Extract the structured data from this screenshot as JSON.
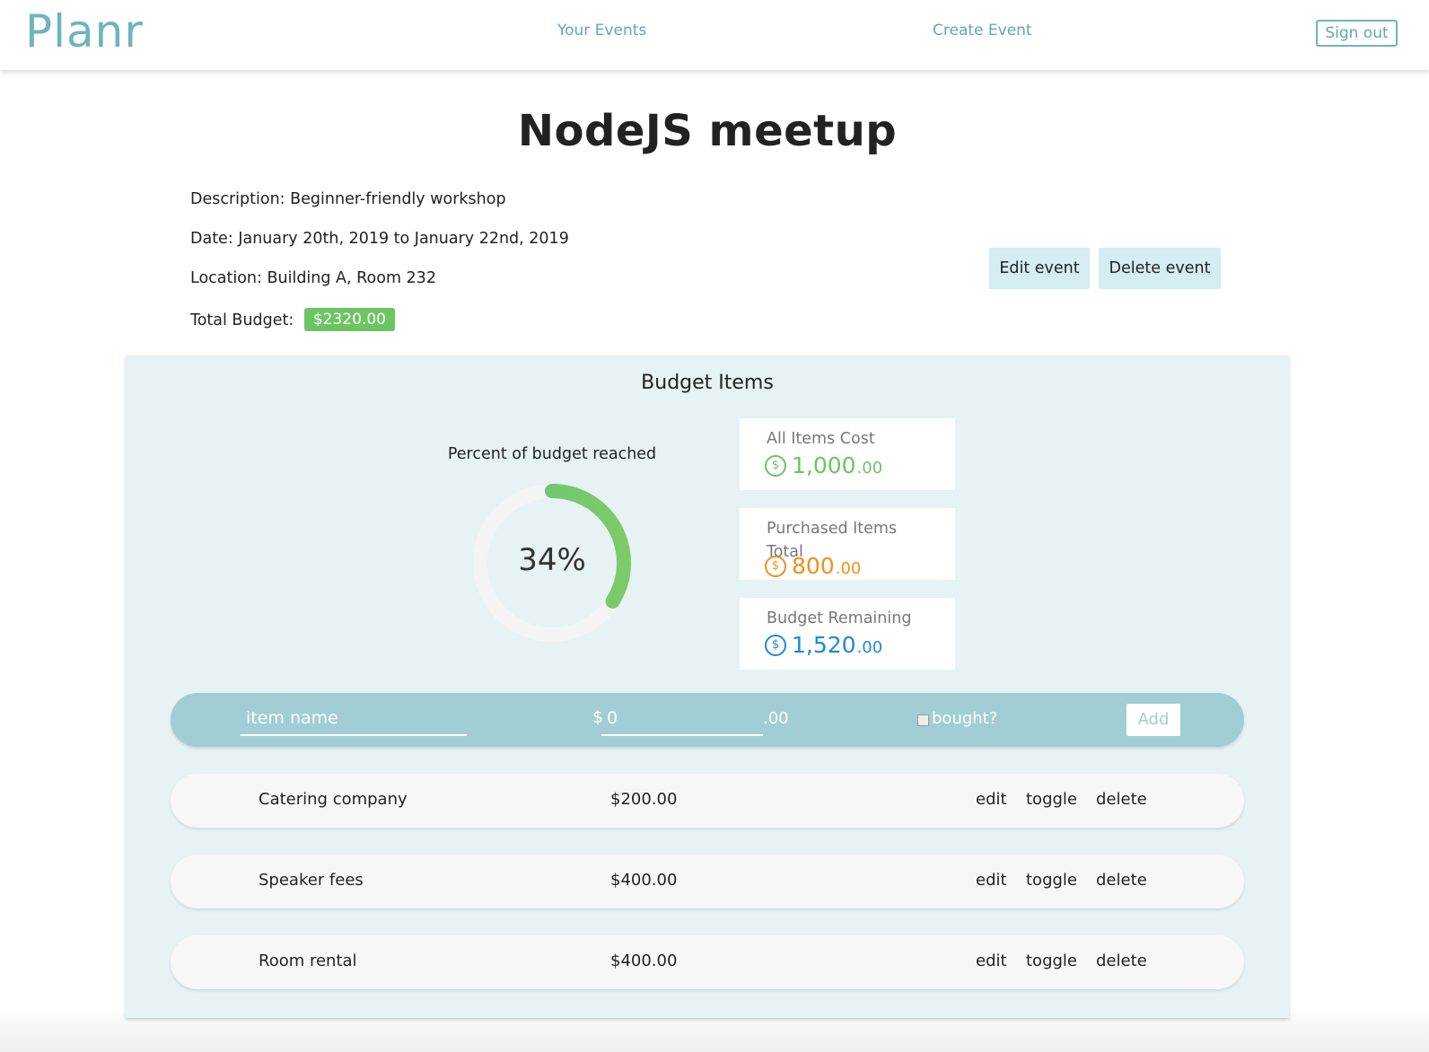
{
  "nav": {
    "logo": "Planr",
    "your_events": "Your Events",
    "create_event": "Create Event",
    "sign_out": "Sign out"
  },
  "event": {
    "title": "NodeJS meetup",
    "description_label": "Description:",
    "description": "Beginner-friendly workshop",
    "date_label": "Date:",
    "date": "January 20th, 2019 to January 22nd, 2019",
    "location_label": "Location:",
    "location": "Building A, Room 232",
    "budget_label": "Total Budget:",
    "budget": "$2320.00",
    "edit_button": "Edit event",
    "delete_button": "Delete event"
  },
  "budget_panel": {
    "title": "Budget Items",
    "gauge_caption": "Percent of budget reached",
    "gauge_percent": 34,
    "gauge_text": "34%",
    "stats": [
      {
        "label": "All Items Cost",
        "dollars": "1,000",
        "cents": ".00",
        "color": "#6dc463"
      },
      {
        "label": "Purchased Items Total",
        "dollars": "800",
        "cents": ".00",
        "color": "#f0901a"
      },
      {
        "label": "Budget Remaining",
        "dollars": "1,520",
        "cents": ".00",
        "color": "#1c8ad6"
      }
    ],
    "coin_symbol": "$"
  },
  "add_form": {
    "name_placeholder": "item name",
    "dollar_sign": "$",
    "amount_placeholder": "0",
    "cents_suffix": ".00",
    "bought_label": "bought?",
    "add_button": "Add"
  },
  "items": [
    {
      "name": "Catering company",
      "price": "$200.00",
      "bought": false
    },
    {
      "name": "Speaker fees",
      "price": "$400.00",
      "bought": true
    },
    {
      "name": "Room rental",
      "price": "$400.00",
      "bought": true
    }
  ],
  "item_actions": {
    "edit": "edit",
    "toggle": "toggle",
    "delete": "delete"
  },
  "colors": {
    "accent": "#6fb3bd",
    "badge_green": "#6dc463",
    "panel_bg": "#e6f2f4",
    "add_bar": "#a1cdd4"
  }
}
